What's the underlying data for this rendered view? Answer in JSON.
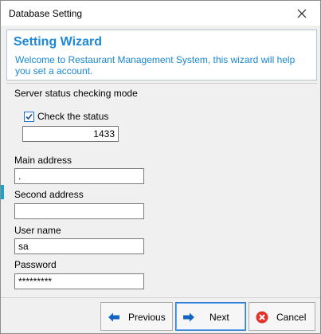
{
  "window": {
    "title": "Database Setting"
  },
  "header": {
    "title": "Setting Wizard",
    "text": "Welcome to  Restaurant Management System, this wizard will help you set a account."
  },
  "form": {
    "server_mode_label": "Server status checking mode",
    "check_status": {
      "label": "Check the status",
      "checked": true
    },
    "port": {
      "value": "1433"
    },
    "main_address": {
      "label": "Main address",
      "value": "."
    },
    "second_address": {
      "label": "Second address",
      "value": ""
    },
    "user_name": {
      "label": "User name",
      "value": "sa"
    },
    "password": {
      "label": "Password",
      "value": "*********"
    }
  },
  "buttons": {
    "previous": "Previous",
    "next": "Next",
    "cancel": "Cancel"
  },
  "colors": {
    "accent": "#1e88d7",
    "cancel_red": "#e2332b",
    "arrow_blue": "#1565c0"
  }
}
